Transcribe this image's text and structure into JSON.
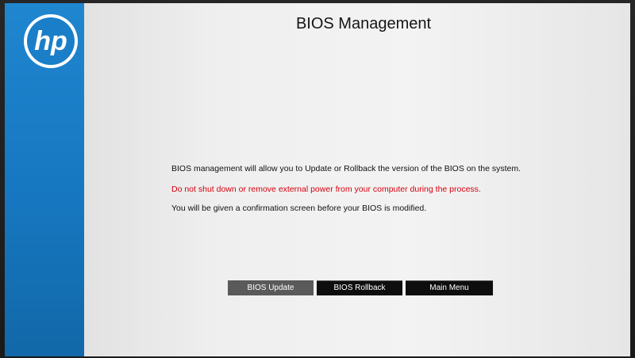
{
  "brand": {
    "logo_text": "hp",
    "sidebar_color": "#1a7fc8"
  },
  "header": {
    "title": "BIOS Management"
  },
  "body": {
    "line1": "BIOS management will allow you to Update or Rollback the version of the BIOS on the system.",
    "line2": "Do not shut down or remove external power from your computer during the process.",
    "line3": "You will be given a confirmation screen before your BIOS is modified.",
    "warning_color": "#d4000c"
  },
  "buttons": {
    "update": "BIOS Update",
    "rollback": "BIOS Rollback",
    "main_menu": "Main Menu",
    "selected": "BIOS Update"
  }
}
